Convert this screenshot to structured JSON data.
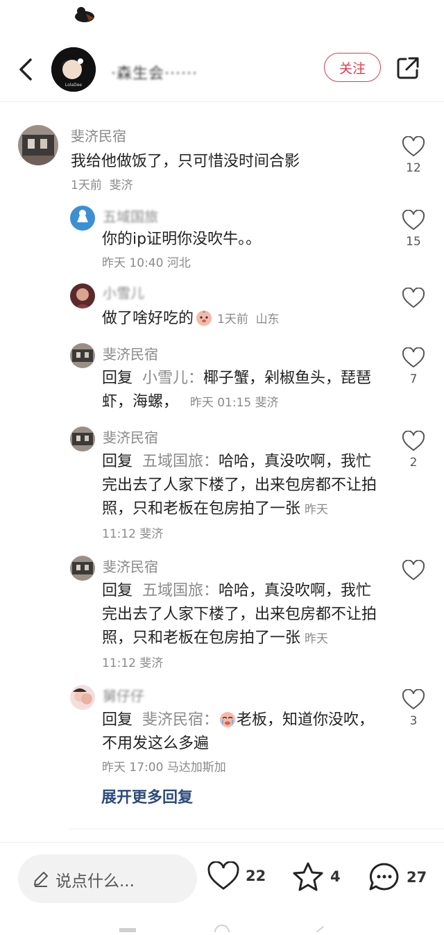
{
  "header": {
    "author_name": "·森生会······",
    "follow_label": "关注"
  },
  "comments": [
    {
      "username": "斐济民宿",
      "text": "我给他做饭了，只可惜没时间合影",
      "time": "1天前",
      "location": "斐济",
      "likes": "12"
    },
    {
      "username": "五域国旅",
      "text": "你的ip证明你没吹牛。。",
      "time": "昨天 10:40",
      "location": "河北",
      "likes": "15"
    },
    {
      "username": "小雪儿",
      "text": "做了啥好吃的",
      "time": "1天前",
      "location": "山东",
      "likes": ""
    },
    {
      "username": "斐济民宿",
      "reply_label": "回复",
      "reply_to": "小雪儿：",
      "text": "椰子蟹，剁椒鱼头，琵琶虾，海螺，",
      "time": "昨天 01:15",
      "location": "斐济",
      "likes": "7"
    },
    {
      "username": "斐济民宿",
      "reply_label": "回复",
      "reply_to": "五域国旅：",
      "text": "哈哈，真没吹啊，我忙完出去了人家下楼了，出来包房都不让拍照，只和老板在包房拍了一张",
      "time": "昨天 11:12",
      "location": "斐济",
      "likes": "2"
    },
    {
      "username": "斐济民宿",
      "reply_label": "回复",
      "reply_to": "五域国旅：",
      "text": "哈哈，真没吹啊，我忙完出去了人家下楼了，出来包房都不让拍照，只和老板在包房拍了一张",
      "time": "昨天 11:12",
      "location": "斐济",
      "likes": ""
    },
    {
      "username": "舅仔仔",
      "reply_label": "回复",
      "reply_to": "斐济民宿：",
      "text": "老板，知道你没吹，不用发这么多遍",
      "time": "昨天 17:00",
      "location": "马达加斯加",
      "likes": "3"
    }
  ],
  "expand_label": "展开更多回复",
  "bottom": {
    "placeholder": "说点什么...",
    "likes": "22",
    "favorites": "4",
    "comments": "27"
  },
  "colors": {
    "accent": "#e23a4a",
    "link": "#2b4a7e",
    "muted": "#8a8a8a"
  }
}
